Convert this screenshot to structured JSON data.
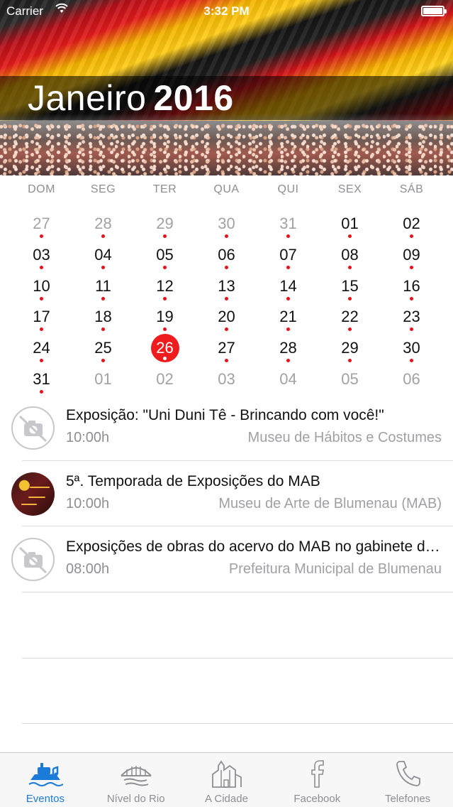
{
  "status_bar": {
    "carrier": "Carrier",
    "time": "3:32 PM"
  },
  "header": {
    "month": "Janeiro",
    "year": "2016"
  },
  "calendar": {
    "weekdays": [
      "DOM",
      "SEG",
      "TER",
      "QUA",
      "QUI",
      "SEX",
      "SÁB"
    ],
    "days": [
      {
        "n": "27",
        "muted": true,
        "dot": true
      },
      {
        "n": "28",
        "muted": true,
        "dot": true
      },
      {
        "n": "29",
        "muted": true,
        "dot": true
      },
      {
        "n": "30",
        "muted": true,
        "dot": true
      },
      {
        "n": "31",
        "muted": true,
        "dot": true
      },
      {
        "n": "01",
        "muted": false,
        "dot": true
      },
      {
        "n": "02",
        "muted": false,
        "dot": true
      },
      {
        "n": "03",
        "muted": false,
        "dot": true
      },
      {
        "n": "04",
        "muted": false,
        "dot": true
      },
      {
        "n": "05",
        "muted": false,
        "dot": true
      },
      {
        "n": "06",
        "muted": false,
        "dot": true
      },
      {
        "n": "07",
        "muted": false,
        "dot": true
      },
      {
        "n": "08",
        "muted": false,
        "dot": true
      },
      {
        "n": "09",
        "muted": false,
        "dot": true
      },
      {
        "n": "10",
        "muted": false,
        "dot": true
      },
      {
        "n": "11",
        "muted": false,
        "dot": true
      },
      {
        "n": "12",
        "muted": false,
        "dot": true
      },
      {
        "n": "13",
        "muted": false,
        "dot": true
      },
      {
        "n": "14",
        "muted": false,
        "dot": true
      },
      {
        "n": "15",
        "muted": false,
        "dot": true
      },
      {
        "n": "16",
        "muted": false,
        "dot": true
      },
      {
        "n": "17",
        "muted": false,
        "dot": true
      },
      {
        "n": "18",
        "muted": false,
        "dot": true
      },
      {
        "n": "19",
        "muted": false,
        "dot": true
      },
      {
        "n": "20",
        "muted": false,
        "dot": true
      },
      {
        "n": "21",
        "muted": false,
        "dot": true
      },
      {
        "n": "22",
        "muted": false,
        "dot": true
      },
      {
        "n": "23",
        "muted": false,
        "dot": true
      },
      {
        "n": "24",
        "muted": false,
        "dot": true
      },
      {
        "n": "25",
        "muted": false,
        "dot": true
      },
      {
        "n": "26",
        "muted": false,
        "dot": true,
        "selected": true
      },
      {
        "n": "27",
        "muted": false,
        "dot": true
      },
      {
        "n": "28",
        "muted": false,
        "dot": true
      },
      {
        "n": "29",
        "muted": false,
        "dot": true
      },
      {
        "n": "30",
        "muted": false,
        "dot": true
      },
      {
        "n": "31",
        "muted": false,
        "dot": true
      },
      {
        "n": "01",
        "muted": true,
        "dot": false
      },
      {
        "n": "02",
        "muted": true,
        "dot": false
      },
      {
        "n": "03",
        "muted": true,
        "dot": false
      },
      {
        "n": "04",
        "muted": true,
        "dot": false
      },
      {
        "n": "05",
        "muted": true,
        "dot": false
      },
      {
        "n": "06",
        "muted": true,
        "dot": false
      }
    ]
  },
  "events": [
    {
      "title": "Exposição: \"Uni Duni Tê - Brincando com você!\"",
      "time": "10:00h",
      "place": "Museu de Hábitos e Costumes",
      "thumb": "no-photo-icon"
    },
    {
      "title": "5ª. Temporada de Exposições do MAB",
      "time": "10:00h",
      "place": "Museu de Arte de Blumenau (MAB)",
      "thumb": "event-photo"
    },
    {
      "title": "Exposições de obras do acervo do MAB no gabinete do prefeito",
      "time": "08:00h",
      "place": "Prefeitura Municipal de Blumenau",
      "thumb": "no-photo-icon"
    }
  ],
  "tabbar": {
    "tabs": [
      {
        "label": "Eventos",
        "icon": "events-ship-icon",
        "active": true
      },
      {
        "label": "Nível do Rio",
        "icon": "bridge-river-icon",
        "active": false
      },
      {
        "label": "A Cidade",
        "icon": "city-church-icon",
        "active": false
      },
      {
        "label": "Facebook",
        "icon": "facebook-icon",
        "active": false
      },
      {
        "label": "Telefones",
        "icon": "phone-icon",
        "active": false
      }
    ]
  },
  "colors": {
    "accent_red": "#ee1c1c",
    "tab_active_blue": "#1a7bd8",
    "muted_gray": "#8e8e93"
  }
}
